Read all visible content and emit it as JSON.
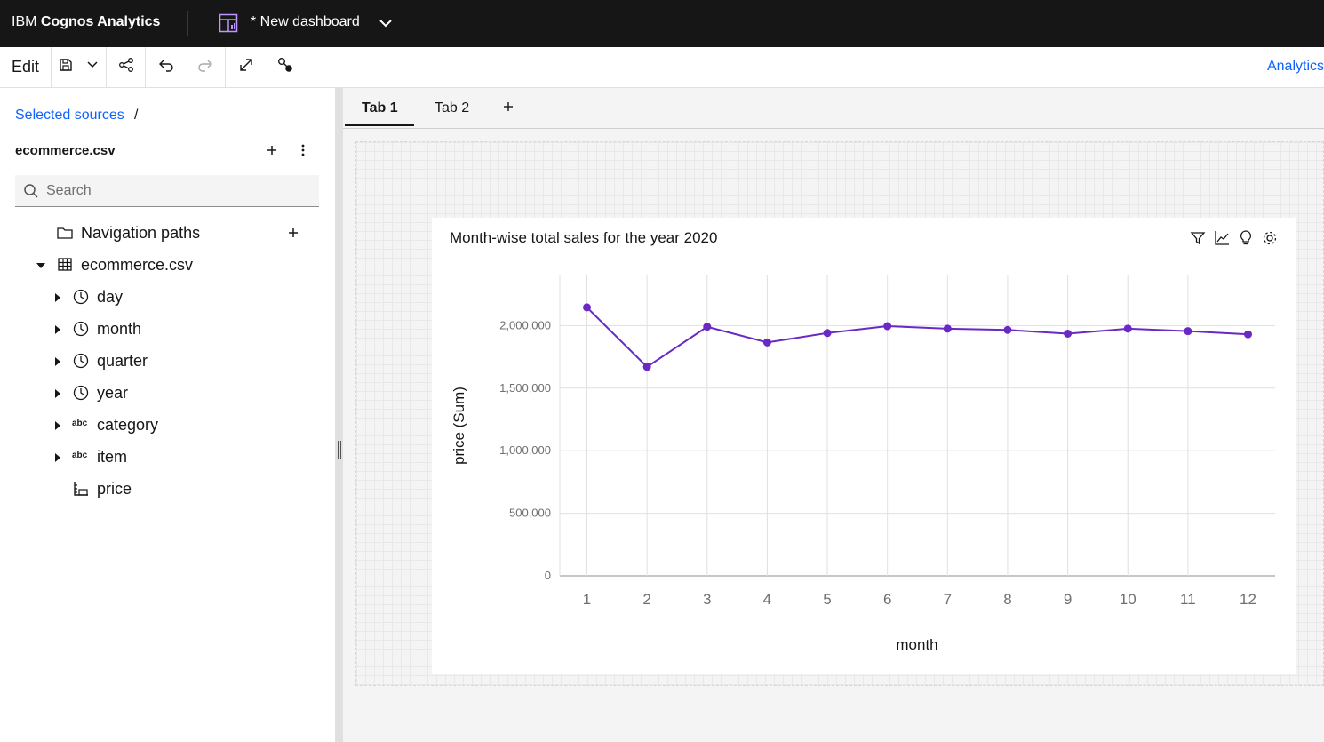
{
  "header": {
    "brand_prefix": "IBM ",
    "brand_name": "Cognos Analytics",
    "dashboard_title": "* New dashboard"
  },
  "toolbar": {
    "edit_label": "Edit",
    "analytics_label": "Analytics",
    "icons": [
      "save-icon",
      "chevron-down-icon",
      "share-icon",
      "undo-icon",
      "redo-icon",
      "expand-icon",
      "filter-connection-icon"
    ]
  },
  "sidebar": {
    "breadcrumb": "Selected sources",
    "breadcrumb_sep": "/",
    "source_title": "ecommerce.csv",
    "search": {
      "placeholder": "Search",
      "value": ""
    },
    "tree": [
      {
        "label": "Navigation paths",
        "icon": "folder-icon"
      },
      {
        "label": "ecommerce.csv",
        "icon": "table-icon"
      },
      {
        "label": "day",
        "icon": "clock-icon"
      },
      {
        "label": "month",
        "icon": "clock-icon"
      },
      {
        "label": "quarter",
        "icon": "clock-icon"
      },
      {
        "label": "year",
        "icon": "clock-icon"
      },
      {
        "label": "category",
        "icon": "abc-icon"
      },
      {
        "label": "item",
        "icon": "abc-icon"
      },
      {
        "label": "price",
        "icon": "measure-icon"
      }
    ],
    "abc_glyph": "abc"
  },
  "tabs": [
    {
      "label": "Tab 1",
      "selected": true
    },
    {
      "label": "Tab 2",
      "selected": false
    }
  ],
  "widget": {
    "title": "Month-wise total sales for the year 2020",
    "icons": [
      "filter-icon",
      "chart-type-icon",
      "insights-icon",
      "properties-icon"
    ]
  },
  "chart_data": {
    "type": "line",
    "xlabel": "month",
    "ylabel": "price (Sum)",
    "categories": [
      "1",
      "2",
      "3",
      "4",
      "5",
      "6",
      "7",
      "8",
      "9",
      "10",
      "11",
      "12"
    ],
    "series": [
      {
        "values": [
          2145000,
          1670000,
          1990000,
          1865000,
          1940000,
          1995000,
          1975000,
          1965000,
          1935000,
          1975000,
          1955000,
          1930000
        ]
      }
    ],
    "yticks": [
      "0",
      "500,000",
      "1,000,000",
      "1,500,000",
      "2,000,000"
    ],
    "ylim": [
      0,
      2400000
    ],
    "grid": true,
    "color": "#6929c4"
  }
}
